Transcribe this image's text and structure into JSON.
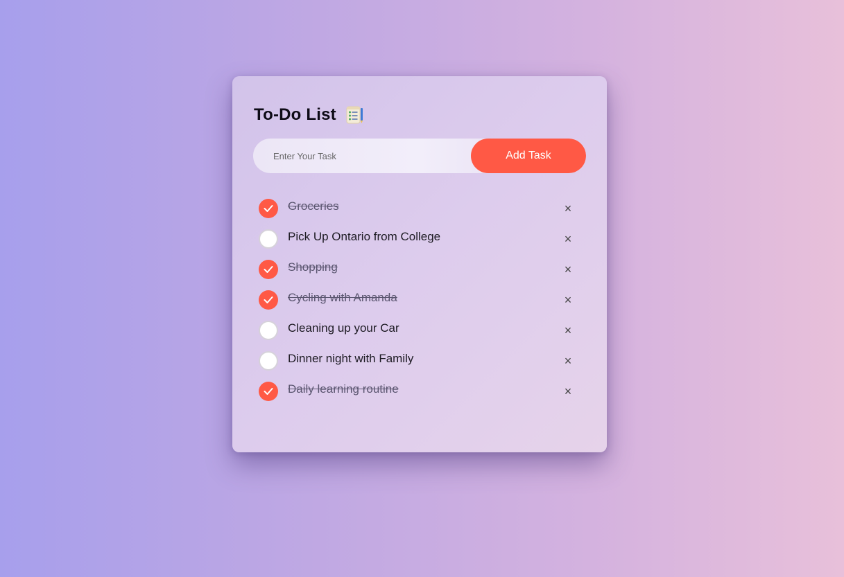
{
  "app": {
    "title": "To-Do List",
    "title_icon": "notepad-checklist-icon"
  },
  "input": {
    "placeholder": "Enter Your Task",
    "value": ""
  },
  "add_button": {
    "label": "Add Task"
  },
  "colors": {
    "accent": "#ff5945",
    "background_start": "#a79fec",
    "background_end": "#e8c0da"
  },
  "tasks": [
    {
      "text": "Groceries",
      "done": true
    },
    {
      "text": "Pick Up Ontario from College",
      "done": false
    },
    {
      "text": "Shopping",
      "done": true
    },
    {
      "text": "Cycling with Amanda",
      "done": true
    },
    {
      "text": "Cleaning up your Car",
      "done": false
    },
    {
      "text": "Dinner night with Family",
      "done": false
    },
    {
      "text": "Daily learning routine",
      "done": true
    }
  ],
  "delete_glyph": "×"
}
